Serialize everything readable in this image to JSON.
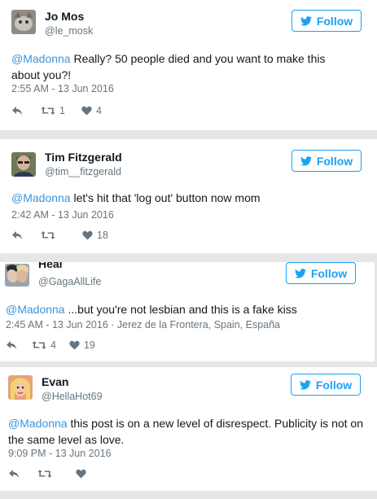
{
  "tweets": [
    {
      "display_name": "Jo Mos",
      "screen_name": "@le_mosk",
      "follow_label": "Follow",
      "mention": "@Madonna",
      "text": " Really? 50 people died and you want to make this about you?!",
      "timestamp": "2:55 AM - 13 Jun 2016",
      "retweets": "1",
      "likes": "4"
    },
    {
      "display_name": "Tim Fitzgerald",
      "screen_name": "@tim__fitzgerald",
      "follow_label": "Follow",
      "mention": "@Madonna",
      "text": " let's hit that 'log out' button now mom",
      "timestamp": "2:42 AM - 13 Jun 2016",
      "retweets": "",
      "likes": "18"
    },
    {
      "display_name": "Heal",
      "screen_name": "@GagaAllLife",
      "follow_label": "Follow",
      "mention": "@Madonna",
      "text": " ...but you're not lesbian and this is a fake kiss",
      "timestamp": "2:45 AM - 13 Jun 2016 · Jerez de la Frontera, Spain, España",
      "retweets": "4",
      "likes": "19"
    },
    {
      "display_name": "Evan",
      "screen_name": "@HellaHot69",
      "follow_label": "Follow",
      "mention": "@Madonna",
      "text": " this post is on a new level of disrespect. Publicity is not on the same level as love.",
      "timestamp": "9:09 PM - 13 Jun 2016",
      "retweets": "",
      "likes": ""
    }
  ],
  "colors": {
    "link_blue": "#3b94d9",
    "follow_blue": "#1da1f2",
    "meta_gray": "#66757f",
    "background": "#e6e6e6"
  },
  "icons": [
    "reply-icon",
    "retweet-icon",
    "like-icon",
    "twitter-bird-icon"
  ]
}
